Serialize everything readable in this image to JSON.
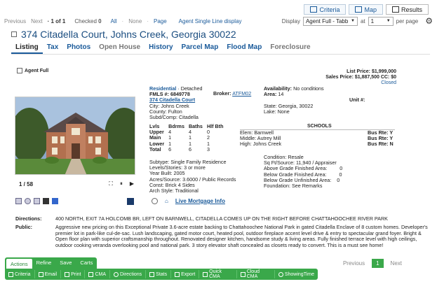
{
  "top_tabs": [
    {
      "label": "Criteria",
      "icon": "criteria-icon"
    },
    {
      "label": "Map",
      "icon": "map-icon"
    },
    {
      "label": "Results",
      "icon": "results-icon"
    }
  ],
  "toolbar": {
    "previous": "Previous",
    "next": "Next",
    "page_of": "· 1 of 1",
    "checked_label": "Checked",
    "checked_count": "0",
    "all": "All",
    "none": "None",
    "page": "Page",
    "agent_single_line": "Agent Single Line display",
    "display_label": "Display",
    "display_value": "Agent Full - Tabbed",
    "at_label": "at",
    "per_page_value": "1",
    "per_page_label": "per page"
  },
  "listing": {
    "address": "374 Citadella Court, Johns Creek, Georgia 30022"
  },
  "nav_tabs": [
    "Listing",
    "Tax",
    "Photos",
    "Open House",
    "History",
    "Parcel Map",
    "Flood Map",
    "Foreclosure"
  ],
  "agent_full_label": "Agent Full",
  "prices": {
    "list_price": "List Price: $1,999,000",
    "sales_price": "Sales Price: $1,887,500 CC: $0",
    "status": "Closed"
  },
  "photo": {
    "counter": "1 / 58"
  },
  "details": {
    "type": "Residential",
    "type_sub": "· Detached",
    "fmls": "FMLS #: 6849778",
    "address_link": "374 Citadella Court",
    "city": "City: Johns Creek",
    "county": "County: Fulton",
    "subd": "Subd/Comp: Citadella",
    "broker_label": "Broker:",
    "broker": "ATFM02",
    "availability_label": "Availability:",
    "availability": "No conditions",
    "area_label": "Area:",
    "area": "14",
    "unit": "Unit #:",
    "state": "State: Georgia, 30022",
    "lake": "Lake: None"
  },
  "rooms": {
    "headers": [
      "Lvls",
      "Bdrms",
      "Baths",
      "Hlf Bth"
    ],
    "rows": [
      [
        "Upper",
        "4",
        "4",
        "0"
      ],
      [
        "Main",
        "1",
        "1",
        "2"
      ],
      [
        "Lower",
        "1",
        "1",
        "1"
      ],
      [
        "Total",
        "6",
        "6",
        "3"
      ]
    ]
  },
  "schools": {
    "heading": "SCHOOLS",
    "elem": "Elem: Barnwell",
    "middle": "Middle: Autrey Mill",
    "high": "High: Johns Creek",
    "bus": [
      "Bus Rte: Y",
      "Bus Rte: Y",
      "Bus Rte: N"
    ]
  },
  "features": {
    "subtype": "Subtype: Single Family Residence",
    "levels": "Levels/Stories: 3 or more",
    "year": "Year Built: 2005",
    "acres": "Acres/Source: 3.6000 / Public Records",
    "const": "Const: Brick 4 Sides",
    "arch": "Arch Style: Traditional"
  },
  "condition": {
    "condition": "Condition: Resale",
    "sqft": "Sq Ft/Source: 11,940 / Appraiser",
    "above": "Above Grade Finished Area:",
    "above_val": "0",
    "below": "Below Grade Finished Area:",
    "below_val": "0",
    "below_unf": "Below Grade Unfinished Area:",
    "below_unf_val": "0",
    "foundation": "Foundation: See Remarks"
  },
  "mortgage_label": "Live Mortgage Info",
  "directions": {
    "label": "Directions:",
    "text": "400 NORTH, EXIT 7A HOLCOMB BR, LEFT ON BARNWELL, CITADELLA COMES UP ON THE RIGHT BEFORE CHATTAHOOCHEE RIVER PARK"
  },
  "public": {
    "label": "Public:",
    "text": "Aggressive new pricing on this Exceptional Private 3.6-acre estate backing to Chattahoochee National Park in gated Citadella Enclave of 8 custom homes. Developer's premier lot in park-like cul-de-sac. Lush landscaping, gated motor court, heated pool, outdoor fireplace accent level drive & entry to spectacular grand foyer. Bright & Open floor plan with superior craftsmanship throughout. Renovated designer kitchen, handsome study & living areas. Fully finished terrace level with high ceilings, outdoor cooking veranda overlooking pool and national park. 3 story elevator shaft concealed as closets ready to convert. This is a must see home!"
  },
  "bottom_tabs": [
    "Actions",
    "Refine",
    "Save",
    "Carts"
  ],
  "bottom_buttons": [
    "Criteria",
    "Email",
    "Print",
    "CMA",
    "Directions",
    "Stats",
    "Export",
    "Quick CMA",
    "Cloud CMA",
    "ShowingTime"
  ],
  "pager": {
    "previous": "Previous",
    "current": "1",
    "next": "Next"
  }
}
